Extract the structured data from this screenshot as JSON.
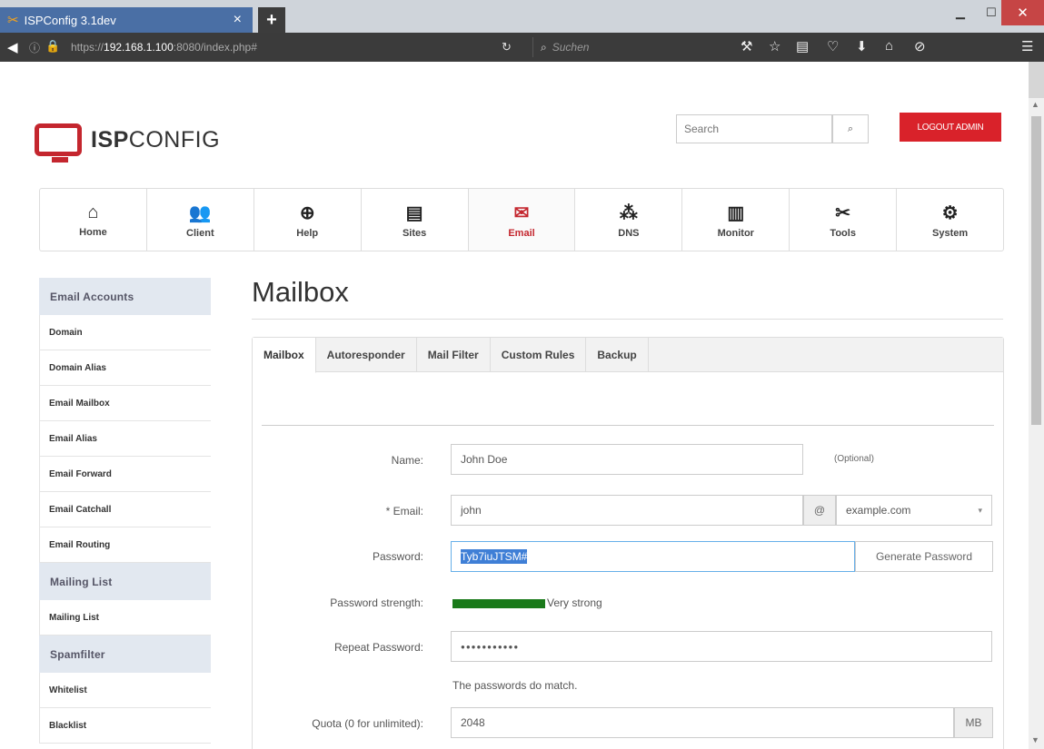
{
  "browser": {
    "tab_title": "ISPConfig 3.1dev",
    "tab_close": "×",
    "new_tab": "+",
    "url_prefix": "https://",
    "url_host": "192.168.1.100",
    "url_rest": ":8080/index.php#",
    "search_placeholder": "Suchen"
  },
  "header": {
    "logo_bold": "ISP",
    "logo_light": "CONFIG",
    "search_placeholder": "Search",
    "logout_label": "LOGOUT ADMIN"
  },
  "modules": [
    {
      "label": "Home",
      "icon": "home-icon",
      "glyph": "⌂"
    },
    {
      "label": "Client",
      "icon": "users-icon",
      "glyph": "👥"
    },
    {
      "label": "Help",
      "icon": "lifebuoy-icon",
      "glyph": "⊕"
    },
    {
      "label": "Sites",
      "icon": "sites-icon",
      "glyph": "▤"
    },
    {
      "label": "Email",
      "icon": "envelope-icon",
      "glyph": "✉"
    },
    {
      "label": "DNS",
      "icon": "dns-icon",
      "glyph": "⁂"
    },
    {
      "label": "Monitor",
      "icon": "monitor-icon",
      "glyph": "▥"
    },
    {
      "label": "Tools",
      "icon": "tools-icon",
      "glyph": "✂"
    },
    {
      "label": "System",
      "icon": "gear-icon",
      "glyph": "⚙"
    }
  ],
  "sidebar": {
    "section1": "Email Accounts",
    "items1": [
      "Domain",
      "Domain Alias",
      "Email Mailbox",
      "Email Alias",
      "Email Forward",
      "Email Catchall",
      "Email Routing"
    ],
    "section2": "Mailing List",
    "items2": [
      "Mailing List"
    ],
    "section3": "Spamfilter",
    "items3": [
      "Whitelist",
      "Blacklist"
    ]
  },
  "page_title": "Mailbox",
  "tabs": [
    "Mailbox",
    "Autoresponder",
    "Mail Filter",
    "Custom Rules",
    "Backup"
  ],
  "form": {
    "name_label": "Name:",
    "name_value": "John Doe",
    "name_hint": "(Optional)",
    "email_label": "* Email:",
    "email_value": "john",
    "at_sign": "@",
    "domain_value": "example.com",
    "password_label": "Password:",
    "password_value": "Tyb7iuJTSM#",
    "generate_label": "Generate Password",
    "strength_label": "Password strength:",
    "strength_text": "Very strong",
    "strength_fraction": 1.0,
    "repeat_label": "Repeat Password:",
    "repeat_value": "●●●●●●●●●●●",
    "match_text": "The passwords do match.",
    "quota_label": "Quota (0 for unlimited):",
    "quota_value": "2048",
    "quota_unit": "MB"
  },
  "colors": {
    "brand_red": "#c4262e",
    "strength_green": "#1a7a1a",
    "selection_blue": "#3f7fd6"
  }
}
